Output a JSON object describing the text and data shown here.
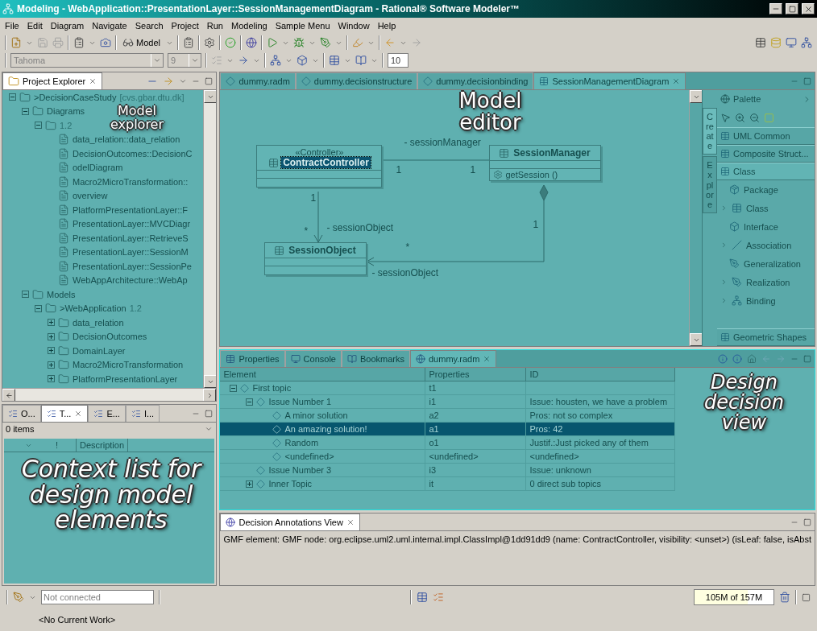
{
  "window": {
    "title": "Modeling - WebApplication::PresentationLayer::SessionManagementDiagram - Rational® Software Modeler™"
  },
  "menu": [
    "File",
    "Edit",
    "Diagram",
    "Navigate",
    "Search",
    "Project",
    "Run",
    "Modeling",
    "Sample Menu",
    "Window",
    "Help"
  ],
  "toolbar": {
    "perspective": "Model",
    "font_name": "Tahoma",
    "font_size": "9",
    "zoom": "10"
  },
  "project_explorer": {
    "title": "Project Explorer",
    "overlay_label": "Model explorer",
    "tree": [
      {
        "label": ">DecisionCaseStudy",
        "suffix": "[cvs.gbar.dtu.dk]",
        "expanded": true,
        "children": [
          {
            "label": "Diagrams",
            "expanded": true,
            "children": [
              {
                "suffix": "1.2",
                "expanded": true,
                "children": [
                  {
                    "label": "data_relation::data_relation"
                  },
                  {
                    "label": "DecisionOutcomes::DecisionC"
                  },
                  {
                    "label": "odelDiagram"
                  },
                  {
                    "label": "Macro2MicroTransformation::"
                  },
                  {
                    "label": "overview"
                  },
                  {
                    "label": "PlatformPresentationLayer::F"
                  },
                  {
                    "label": "PresentationLayer::MVCDiagr"
                  },
                  {
                    "label": "PresentationLayer::RetrieveS"
                  },
                  {
                    "label": "PresentationLayer::SessionM"
                  },
                  {
                    "label": "PresentationLayer::SessionPe"
                  },
                  {
                    "label": "WebAppArchitecture::WebAp"
                  }
                ]
              }
            ]
          },
          {
            "label": "Models",
            "expanded": true,
            "children": [
              {
                "label": ">WebApplication",
                "suffix": "1.2",
                "expanded": true,
                "children": [
                  {
                    "label": "data_relation",
                    "expanded": false
                  },
                  {
                    "label": "DecisionOutcomes",
                    "expanded": false
                  },
                  {
                    "label": "DomainLayer",
                    "expanded": false
                  },
                  {
                    "label": "Macro2MicroTransformation",
                    "expanded": false
                  },
                  {
                    "label": "PlatformPresentationLayer",
                    "expanded": false
                  }
                ]
              }
            ]
          }
        ]
      }
    ]
  },
  "editor": {
    "tabs": [
      {
        "label": "dummy.radm",
        "selected": false
      },
      {
        "label": "dummy.decisionstructure",
        "selected": false
      },
      {
        "label": "dummy.decisionbinding",
        "selected": false
      },
      {
        "label": "SessionManagementDiagram",
        "selected": true
      }
    ],
    "overlay_label": "Model editor",
    "classes": [
      {
        "stereotype": "«Controller»",
        "name": "ContractController",
        "selected": true
      },
      {
        "name": "SessionManager",
        "selected": false,
        "operations": [
          "getSession ()"
        ]
      },
      {
        "name": "SessionObject",
        "selected": false
      }
    ],
    "associations": [
      {
        "kind": "association",
        "role": "- sessionManager",
        "source_multiplicity": "1",
        "target_multiplicity": "1"
      },
      {
        "kind": "directed",
        "role": "- sessionObject",
        "source_multiplicity": "1",
        "target_multiplicity": "*"
      },
      {
        "kind": "composition",
        "role": "- sessionObject",
        "source_multiplicity": "1",
        "target_multiplicity": "*"
      }
    ],
    "palette": {
      "title": "Palette",
      "side_tabs": [
        {
          "label": "Create",
          "selected": true
        },
        {
          "label": "Explore",
          "selected": false
        }
      ],
      "drawers": [
        {
          "label": "UML Common",
          "expanded": false
        },
        {
          "label": "Composite Struct...",
          "expanded": false
        },
        {
          "label": "Class",
          "expanded": true,
          "items": [
            {
              "label": "Package",
              "has_submenu": false
            },
            {
              "label": "Class",
              "has_submenu": true
            },
            {
              "label": "Interface",
              "has_submenu": false
            },
            {
              "label": "Association",
              "has_submenu": true
            },
            {
              "label": "Generalization",
              "has_submenu": false
            },
            {
              "label": "Realization",
              "has_submenu": true
            },
            {
              "label": "Binding",
              "has_submenu": true
            }
          ]
        },
        {
          "label": "Geometric Shapes",
          "expanded": false
        }
      ]
    }
  },
  "decision_view": {
    "tabs": [
      {
        "label": "Properties",
        "selected": false
      },
      {
        "label": "Console",
        "selected": false
      },
      {
        "label": "Bookmarks",
        "selected": false
      },
      {
        "label": "dummy.radm",
        "selected": true
      }
    ],
    "overlay_label": "Design decision view",
    "columns": [
      "Element",
      "Properties",
      "ID"
    ],
    "rows": [
      {
        "element": "First topic",
        "properties": "t1",
        "expanded": true,
        "selected": false,
        "children": [
          {
            "element": "Issue Number 1",
            "properties": "i1",
            "id": "Issue: housten, we have a problem",
            "expanded": true,
            "selected": false,
            "children": [
              {
                "element": "A minor solution",
                "properties": "a2",
                "id": "Pros: not so complex",
                "selected": false
              },
              {
                "element": "An amazing solution!",
                "properties": "a1",
                "id": "Pros: 42",
                "selected": true
              },
              {
                "element": "Random",
                "properties": "o1",
                "id": "Justif.:Just picked any of them",
                "selected": false
              },
              {
                "element": "<undefined>",
                "properties": "<undefined>",
                "id": "<undefined>",
                "selected": false
              }
            ]
          },
          {
            "element": "Issue Number 3",
            "properties": "i3",
            "id": "Issue: unknown",
            "selected": false
          },
          {
            "element": "Inner Topic",
            "properties": "it",
            "id": "0 direct sub topics",
            "expanded": false,
            "selected": false
          }
        ]
      }
    ]
  },
  "tasks": {
    "tabs": [
      {
        "label": "O...",
        "selected": false
      },
      {
        "label": "T...",
        "selected": true
      },
      {
        "label": "E...",
        "selected": false
      },
      {
        "label": "I...",
        "selected": false
      }
    ],
    "count": "0 items",
    "columns": [
      "!",
      "Description"
    ],
    "overlay_label": "Context list for design model elements"
  },
  "annotations": {
    "title": "Decision Annotations View",
    "text": "GMF element: GMF node: org.eclipse.uml2.uml.internal.impl.ClassImpl@1dd91dd9 (name: ContractController, visibility: <unset>) (isLeaf: false, isAbst"
  },
  "status_bar": {
    "connection_placeholder": "Not connected",
    "memory": {
      "reading": "105M of 157M",
      "level": 0.67
    },
    "work": "<No Current Work>"
  }
}
